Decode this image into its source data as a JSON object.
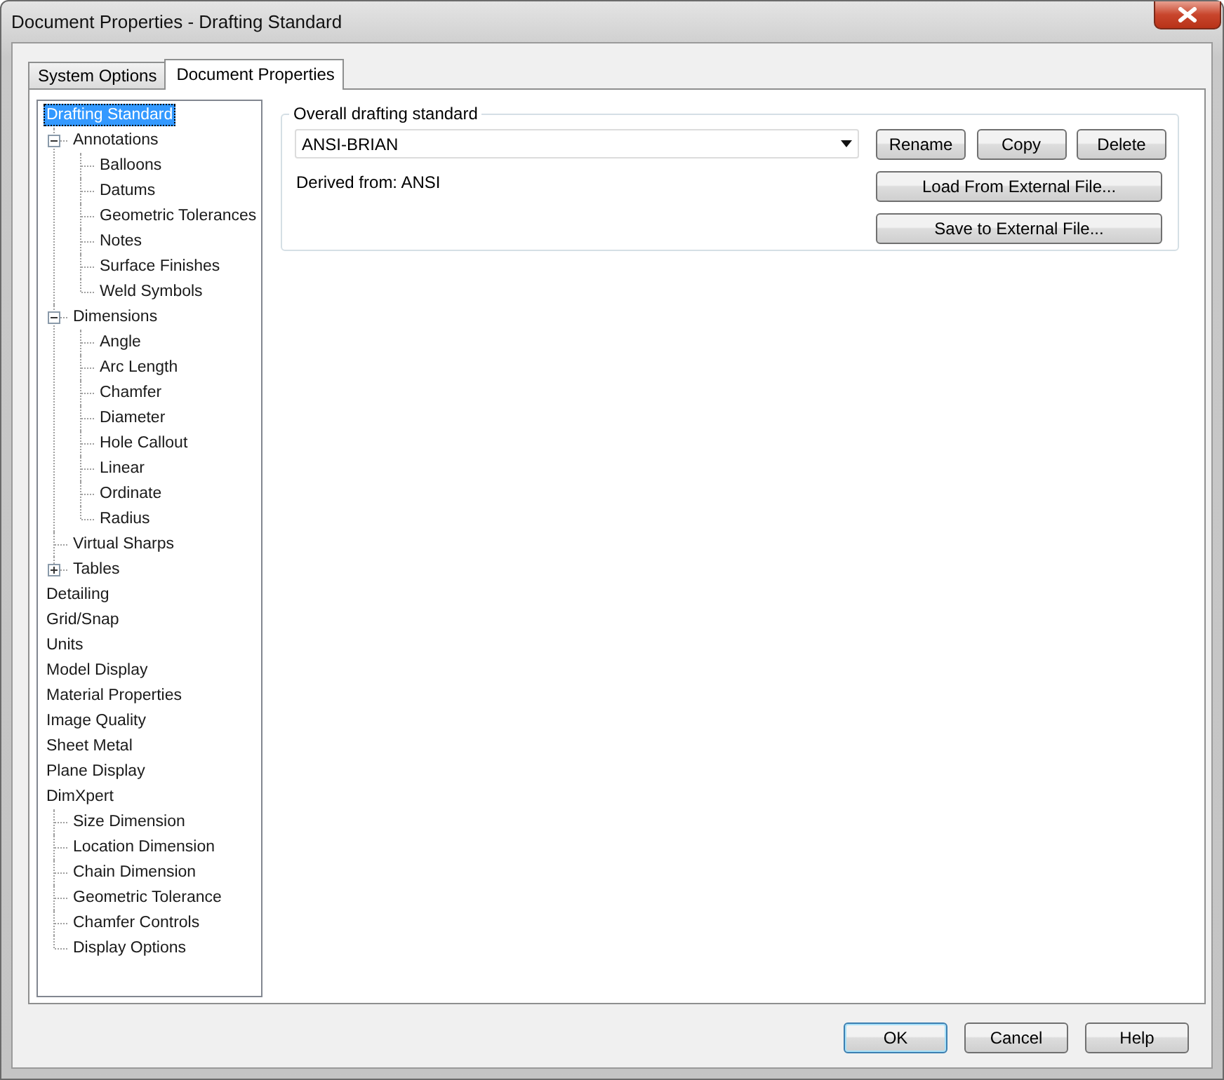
{
  "window": {
    "title": "Document Properties - Drafting Standard"
  },
  "tabs": [
    {
      "label": "System Options",
      "selected": false
    },
    {
      "label": "Document Properties",
      "selected": true
    }
  ],
  "tree": [
    {
      "label": "Drafting Standard",
      "selected": true,
      "children": [
        {
          "label": "Annotations",
          "selected": false,
          "expanded": true,
          "children": [
            {
              "label": "Balloons",
              "selected": false
            },
            {
              "label": "Datums",
              "selected": false
            },
            {
              "label": "Geometric Tolerances",
              "selected": false
            },
            {
              "label": "Notes",
              "selected": false
            },
            {
              "label": "Surface Finishes",
              "selected": false
            },
            {
              "label": "Weld Symbols",
              "selected": false
            }
          ]
        },
        {
          "label": "Dimensions",
          "selected": false,
          "expanded": true,
          "children": [
            {
              "label": "Angle",
              "selected": false
            },
            {
              "label": "Arc Length",
              "selected": false
            },
            {
              "label": "Chamfer",
              "selected": false
            },
            {
              "label": "Diameter",
              "selected": false
            },
            {
              "label": "Hole Callout",
              "selected": false
            },
            {
              "label": "Linear",
              "selected": false
            },
            {
              "label": "Ordinate",
              "selected": false
            },
            {
              "label": "Radius",
              "selected": false
            }
          ]
        },
        {
          "label": "Virtual Sharps",
          "selected": false
        },
        {
          "label": "Tables",
          "selected": false,
          "expanded": false
        }
      ]
    },
    {
      "label": "Detailing",
      "selected": false
    },
    {
      "label": "Grid/Snap",
      "selected": false
    },
    {
      "label": "Units",
      "selected": false
    },
    {
      "label": "Model Display",
      "selected": false
    },
    {
      "label": "Material Properties",
      "selected": false
    },
    {
      "label": "Image Quality",
      "selected": false
    },
    {
      "label": "Sheet Metal",
      "selected": false
    },
    {
      "label": "Plane Display",
      "selected": false
    },
    {
      "label": "DimXpert",
      "selected": false,
      "children": [
        {
          "label": "Size Dimension",
          "selected": false
        },
        {
          "label": "Location Dimension",
          "selected": false
        },
        {
          "label": "Chain Dimension",
          "selected": false
        },
        {
          "label": "Geometric Tolerance",
          "selected": false
        },
        {
          "label": "Chamfer Controls",
          "selected": false
        },
        {
          "label": "Display Options",
          "selected": false
        }
      ]
    }
  ],
  "group": {
    "legend": "Overall drafting standard",
    "standard": {
      "value": "ANSI-BRIAN"
    },
    "derived": "Derived from: ANSI",
    "buttons": [
      "Rename",
      "Copy",
      "Delete"
    ],
    "file_buttons": [
      "Load From External File...",
      "Save to External File..."
    ]
  },
  "footer_buttons": [
    {
      "label": "OK",
      "default": true
    },
    {
      "label": "Cancel",
      "default": false
    },
    {
      "label": "Help",
      "default": false
    }
  ]
}
